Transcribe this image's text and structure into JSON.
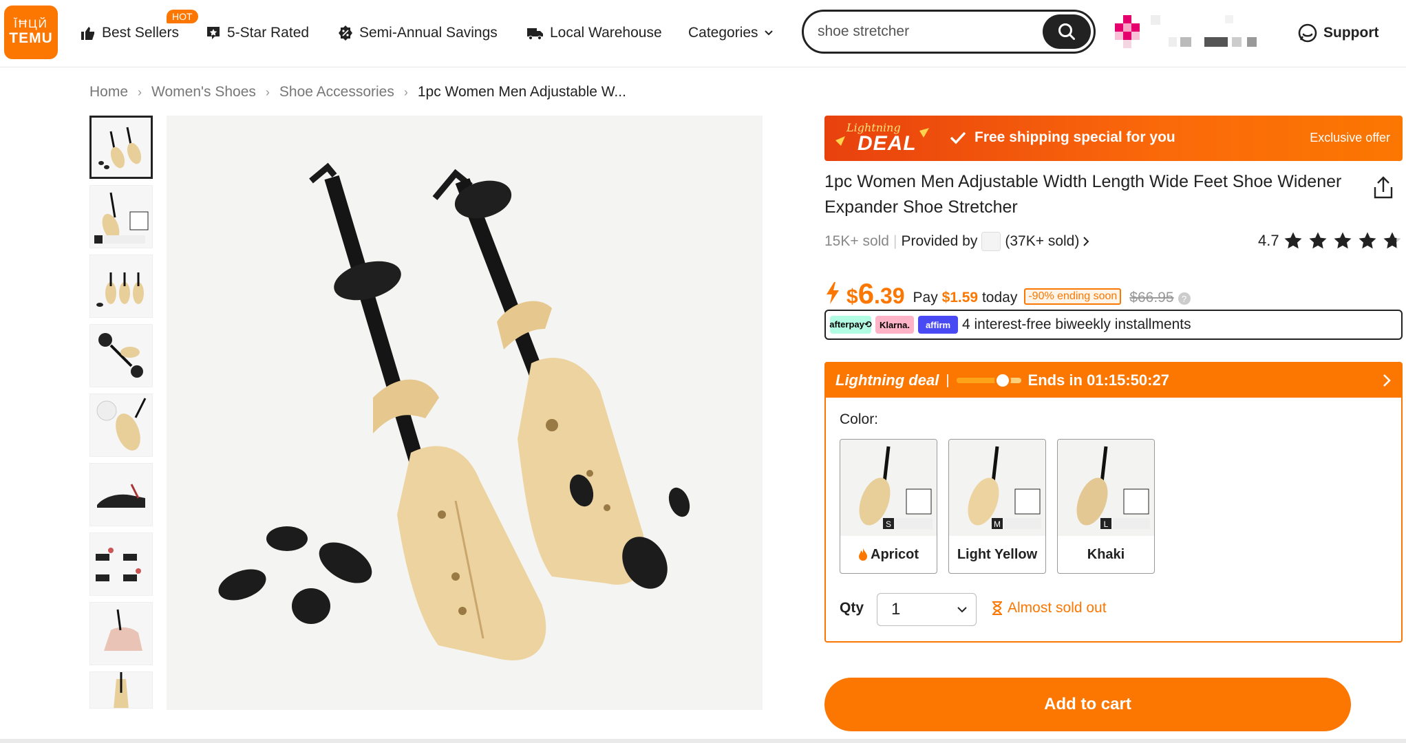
{
  "header": {
    "logo": {
      "mark": "ĬĦЦЙ",
      "word": "TEMU"
    },
    "nav": [
      {
        "label": "Best Sellers",
        "icon": "thumbs-up-icon"
      },
      {
        "label": "5-Star Rated",
        "icon": "star-badge-icon"
      },
      {
        "label": "Semi-Annual Savings",
        "icon": "percent-badge-icon"
      },
      {
        "label": "Local Warehouse",
        "icon": "truck-icon"
      },
      {
        "label": "Categories",
        "icon": "chevron-down-icon"
      }
    ],
    "hot_badge": "HOT",
    "search": {
      "value": "shoe stretcher"
    },
    "support": "Support"
  },
  "breadcrumb": [
    "Home",
    "Women's Shoes",
    "Shoe Accessories",
    "1pc Women Men Adjustable W..."
  ],
  "gallery": {
    "thumb_count": 9,
    "active_index": 0
  },
  "deal_banner": {
    "badge_line1": "Lightning",
    "badge_line2": "DEAL",
    "free_shipping": "Free shipping special for you",
    "exclusive": "Exclusive offer"
  },
  "product": {
    "title": "1pc Women Men Adjustable Width Length Wide Feet Shoe Widener Expander Shoe Stretcher",
    "sold": "15K+ sold",
    "provided_by": "Provided by",
    "store_sold": "(37K+ sold)",
    "rating": "4.7",
    "rating_value": 4.7
  },
  "price": {
    "currency": "$",
    "integer": "6",
    "decimal": ".39",
    "pay_prefix": "Pay",
    "pay_amount": "$1.59",
    "pay_suffix": "today",
    "discount": "-90% ending soon",
    "original": "$66.95"
  },
  "installments": {
    "providers": [
      "afterpay⟲",
      "Klarna.",
      "affirm"
    ],
    "text": "4 interest-free biweekly installments"
  },
  "lightning": {
    "title": "Lightning deal",
    "separator": "|",
    "ends": "Ends in 01:15:50:27",
    "progress": 0.72
  },
  "options": {
    "color_label": "Color:",
    "colors": [
      {
        "label": "Apricot",
        "size": "S"
      },
      {
        "label": "Light Yellow",
        "size": "M"
      },
      {
        "label": "Khaki",
        "size": "L"
      }
    ],
    "qty_label": "Qty",
    "qty_value": "1",
    "stock": "Almost sold out"
  },
  "cart_button": "Add to cart",
  "colors": {
    "accent": "#fb7701",
    "dark": "#222222"
  }
}
